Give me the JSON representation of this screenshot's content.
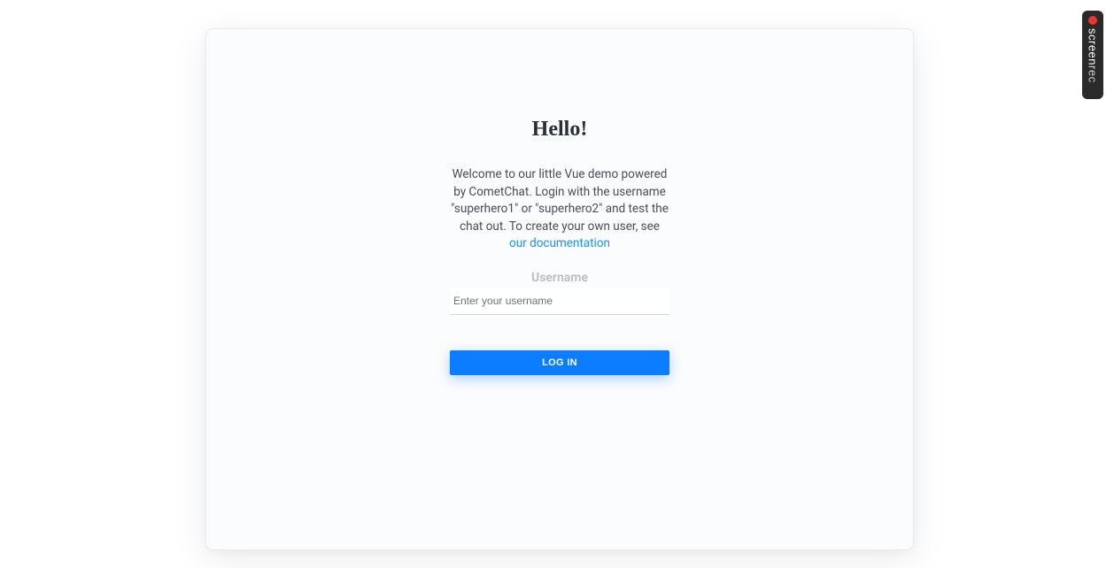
{
  "card": {
    "title": "Hello!",
    "description_part1": "Welcome to our little Vue demo powered by CometChat. Login with the username \"superhero1\" or \"superhero2\" and test the chat out. To create your own user, see ",
    "doc_link_text": "our documentation",
    "username_label": "Username",
    "username_placeholder": "Enter your username",
    "username_value": "",
    "login_button": "LOG IN"
  },
  "overlay": {
    "screenrec_label_screen": "screen",
    "screenrec_label_rec": "rec"
  }
}
